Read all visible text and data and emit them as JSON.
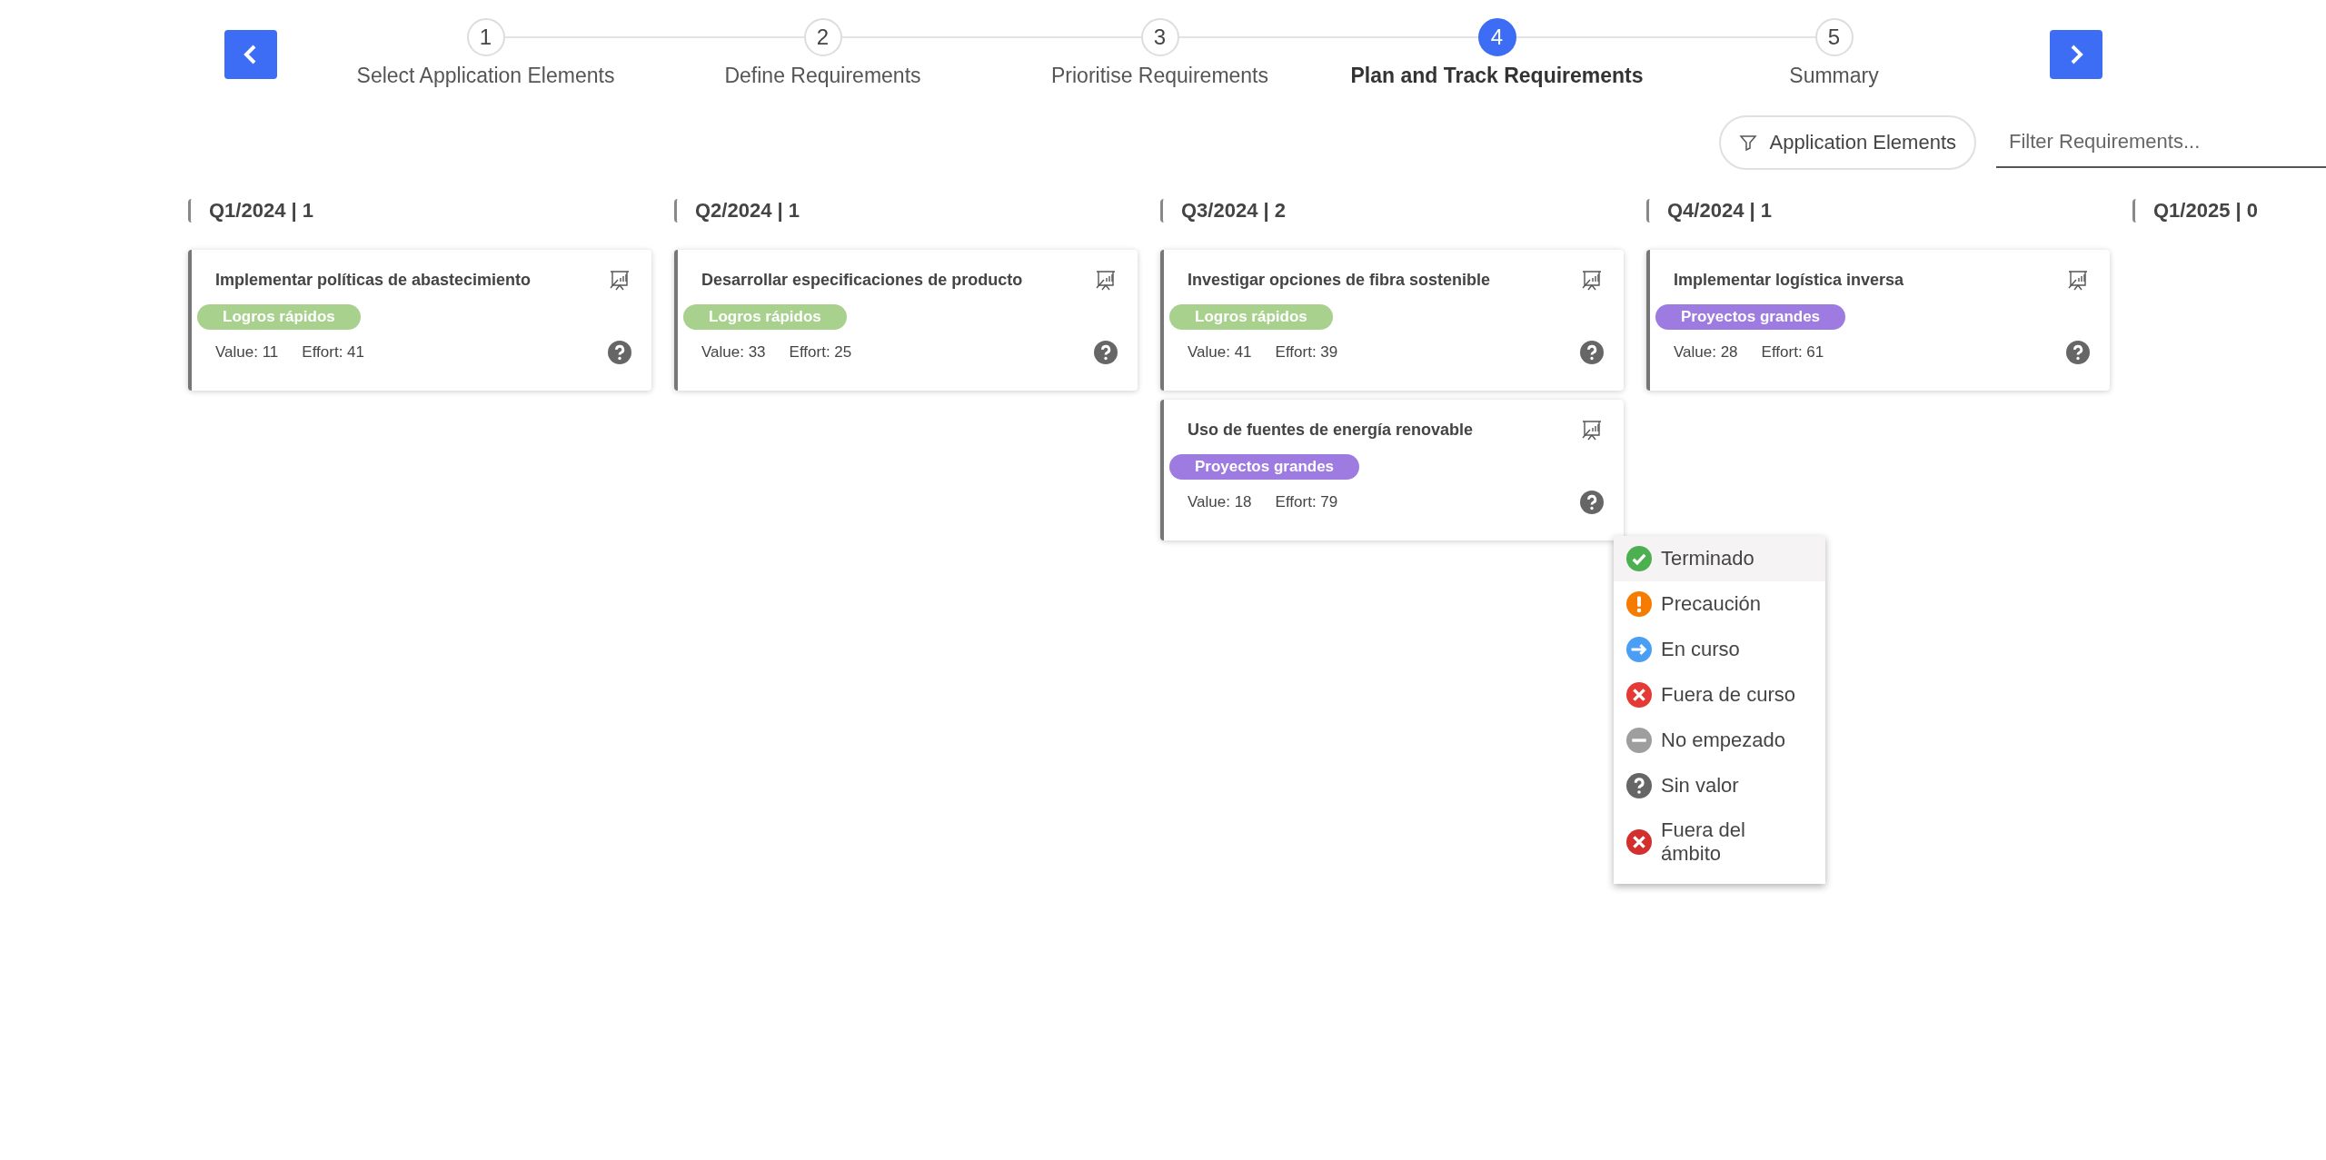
{
  "steps": [
    {
      "number": "1",
      "label": "Select Application Elements",
      "selected": false
    },
    {
      "number": "2",
      "label": "Define Requirements",
      "selected": false
    },
    {
      "number": "3",
      "label": "Prioritise Requirements",
      "selected": false
    },
    {
      "number": "4",
      "label": "Plan and Track Requirements",
      "selected": true
    },
    {
      "number": "5",
      "label": "Summary",
      "selected": false
    }
  ],
  "filter_button": {
    "label": "Application Elements"
  },
  "filter_field": {
    "placeholder": "Filter Requirements..."
  },
  "quarters": [
    {
      "title": "Q1/2024 | 1",
      "cards": [
        {
          "title": "Implementar políticas de abastecimiento",
          "tag": {
            "label": "Logros rápidos",
            "color": "#a9d18e"
          },
          "value": "Value: 11",
          "effort": "Effort: 41",
          "kind": "unknown"
        }
      ]
    },
    {
      "title": "Q2/2024 | 1",
      "cards": [
        {
          "title": "Desarrollar especificaciones de producto",
          "tag": {
            "label": "Logros rápidos",
            "color": "#a9d18e"
          },
          "value": "Value: 33",
          "effort": "Effort: 25",
          "kind": "unknown"
        }
      ]
    },
    {
      "title": "Q3/2024 | 2",
      "cards": [
        {
          "title": "Investigar opciones de fibra sostenible",
          "tag": {
            "label": "Logros rápidos",
            "color": "#a9d18e"
          },
          "value": "Value: 41",
          "effort": "Effort: 39",
          "kind": "unknown"
        },
        {
          "title": "Uso de fuentes de energía renovable",
          "tag": {
            "label": "Proyectos grandes",
            "color": "#9d7be0"
          },
          "value": "Value: 18",
          "effort": "Effort: 79",
          "kind": "unknown",
          "status_menu": [
            {
              "label": "Terminado",
              "kind": "done",
              "selected": true
            },
            {
              "label": "Precaución",
              "kind": "caution",
              "selected": false
            },
            {
              "label": "En curso",
              "kind": "in_progress",
              "selected": false
            },
            {
              "label": "Fuera de curso",
              "kind": "off_track",
              "selected": false
            },
            {
              "label": "No empezado",
              "kind": "not_started",
              "selected": false
            },
            {
              "label": "Sin valor",
              "kind": "unknown",
              "selected": false
            },
            {
              "label": "Fuera del ámbito",
              "kind": "out_of_scope",
              "selected": false
            }
          ]
        }
      ]
    },
    {
      "title": "Q4/2024 | 1",
      "cards": [
        {
          "title": "Implementar logística inversa",
          "tag": {
            "label": "Proyectos grandes",
            "color": "#9d7be0"
          },
          "value": "Value: 28",
          "effort": "Effort: 61",
          "kind": "unknown"
        }
      ]
    },
    {
      "title": "Q1/2025 | 0"
    }
  ]
}
